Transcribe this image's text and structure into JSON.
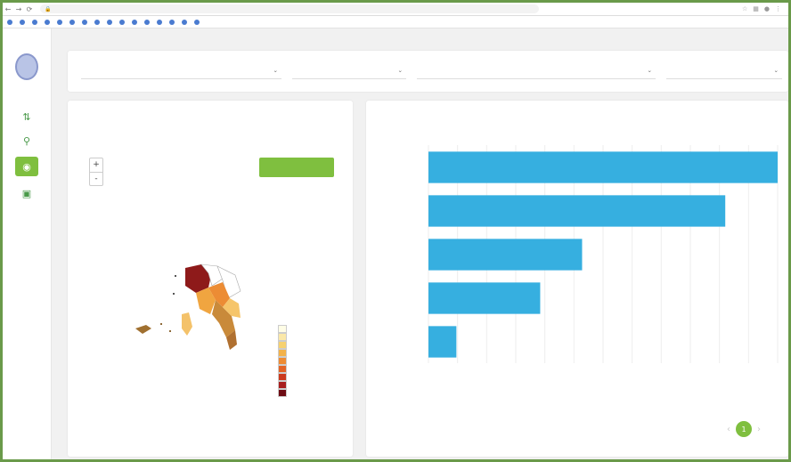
{
  "browser": {
    "address": "",
    "bookmarks": [
      "",
      "",
      "",
      "",
      "",
      "",
      "",
      "",
      "",
      "",
      "",
      "",
      "",
      "",
      "",
      ""
    ]
  },
  "sidebar": {
    "items": [
      "chart-icon",
      "location-icon",
      "eye-icon",
      "video-icon"
    ],
    "active_index": 2
  },
  "filters": [
    {
      "label": "",
      "value": ""
    },
    {
      "label": "",
      "value": ""
    },
    {
      "label": "",
      "value": ""
    },
    {
      "label": "",
      "value": ""
    }
  ],
  "map_card": {
    "title": "",
    "crumbs": [
      "",
      "",
      ""
    ],
    "zoom_in": "+",
    "zoom_out": "-",
    "action_button": "",
    "legend": [
      {
        "label": "",
        "color": "#fffde6"
      },
      {
        "label": "",
        "color": "#fbe8a8"
      },
      {
        "label": "",
        "color": "#f6d170"
      },
      {
        "label": "",
        "color": "#f3b24a"
      },
      {
        "label": "",
        "color": "#ee8c34"
      },
      {
        "label": "",
        "color": "#e36426"
      },
      {
        "label": "",
        "color": "#cb3a1e"
      },
      {
        "label": "",
        "color": "#a81e1e"
      },
      {
        "label": "",
        "color": "#6e0d14"
      }
    ],
    "credit": ""
  },
  "chart_card": {
    "title": ""
  },
  "chart_data": {
    "type": "bar",
    "orientation": "horizontal",
    "categories": [
      "",
      "",
      "",
      "",
      ""
    ],
    "values": [
      100,
      85,
      44,
      32,
      8
    ],
    "xlabel": "",
    "xticks": [
      "",
      "",
      "",
      "",
      "",
      "",
      "",
      "",
      "",
      "",
      "",
      "",
      ""
    ],
    "xlim": [
      0,
      100
    ],
    "grid": true,
    "bar_color": "#36afe0"
  },
  "pagination": {
    "prev": "‹",
    "current": "1",
    "next": "›"
  }
}
